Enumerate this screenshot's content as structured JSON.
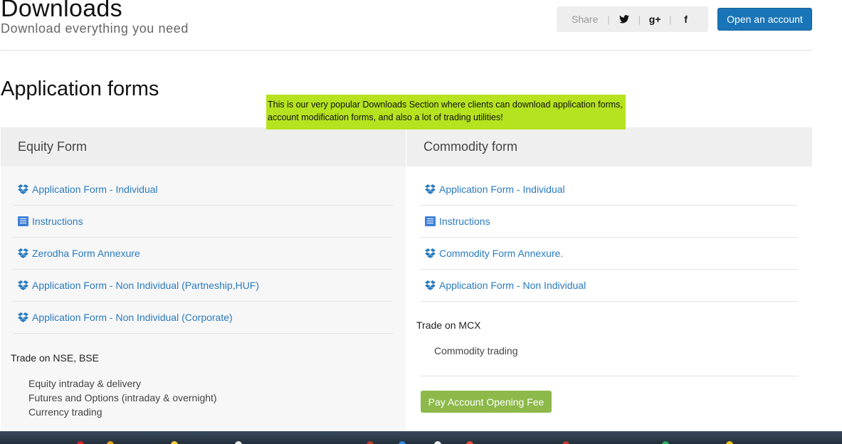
{
  "header": {
    "title": "Downloads",
    "subtitle": "Download everything you need",
    "share_label": "Share",
    "share_icons": [
      "twitter-icon",
      "google-plus-icon",
      "facebook-icon"
    ],
    "twitter_glyph": "🐦",
    "gplus_glyph": "g+",
    "facebook_glyph": "f",
    "open_account_label": "Open an account"
  },
  "section": {
    "title": "Application forms",
    "annotation": "This is our very popular Downloads Section where clients can download application forms, account modification forms, and also a lot of trading utilities!"
  },
  "equity": {
    "heading": "Equity Form",
    "items": [
      {
        "icon": "dropbox-icon",
        "label": "Application Form - Individual"
      },
      {
        "icon": "document-icon",
        "label": "Instructions"
      },
      {
        "icon": "dropbox-icon",
        "label": "Zerodha Form Annexure"
      },
      {
        "icon": "dropbox-icon",
        "label": "Application Form - Non Individual (Partneship,HUF)"
      },
      {
        "icon": "dropbox-icon",
        "label": "Application Form - Non Individual (Corporate)"
      }
    ],
    "trade_heading": "Trade on NSE, BSE",
    "trade_items": [
      "Equity intraday & delivery",
      "Futures and Options (intraday & overnight)",
      "Currency trading"
    ]
  },
  "commodity": {
    "heading": "Commodity form",
    "items": [
      {
        "icon": "dropbox-icon",
        "label": "Application Form - Individual"
      },
      {
        "icon": "document-icon",
        "label": "Instructions"
      },
      {
        "icon": "dropbox-icon",
        "label": "Commodity Form Annexure."
      },
      {
        "icon": "dropbox-icon",
        "label": "Application Form - Non Individual"
      }
    ],
    "trade_heading": "Trade on MCX",
    "trade_items": [
      "Commodity trading"
    ],
    "pay_label": "Pay Account Opening Fee"
  },
  "colors": {
    "link": "#2a7bbf",
    "primary_button": "#1a75b8",
    "pay_button": "#8db94a",
    "annotation_bg": "#b6e31f"
  }
}
